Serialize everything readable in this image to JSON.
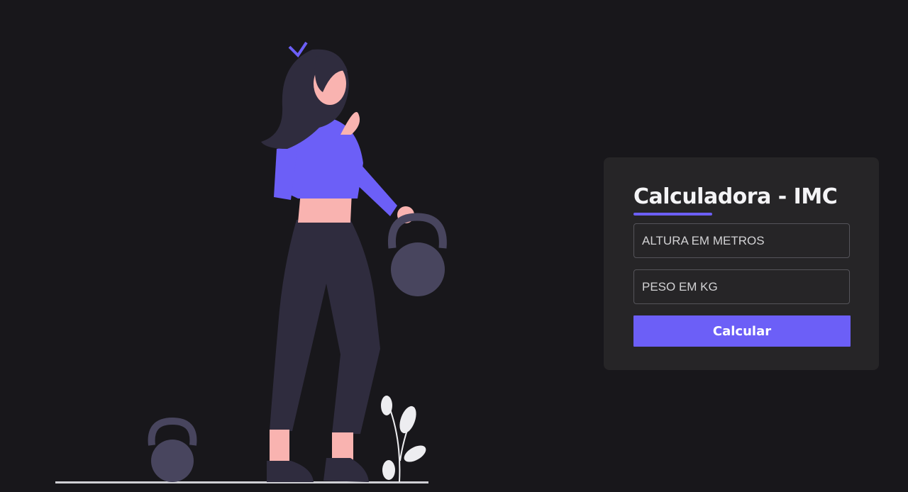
{
  "card": {
    "title": "Calculadora - IMC",
    "height_placeholder": "ALTURA EM METROS",
    "weight_placeholder": "PESO EM KG",
    "button_label": "Calcular"
  },
  "colors": {
    "background": "#18171b",
    "card": "#262527",
    "accent": "#6c5ff7",
    "skin": "#f9b3b0",
    "pants": "#2f2c3e",
    "kettlebell": "#48455e"
  },
  "illustration": {
    "subject": "woman-lifting-kettlebell"
  }
}
